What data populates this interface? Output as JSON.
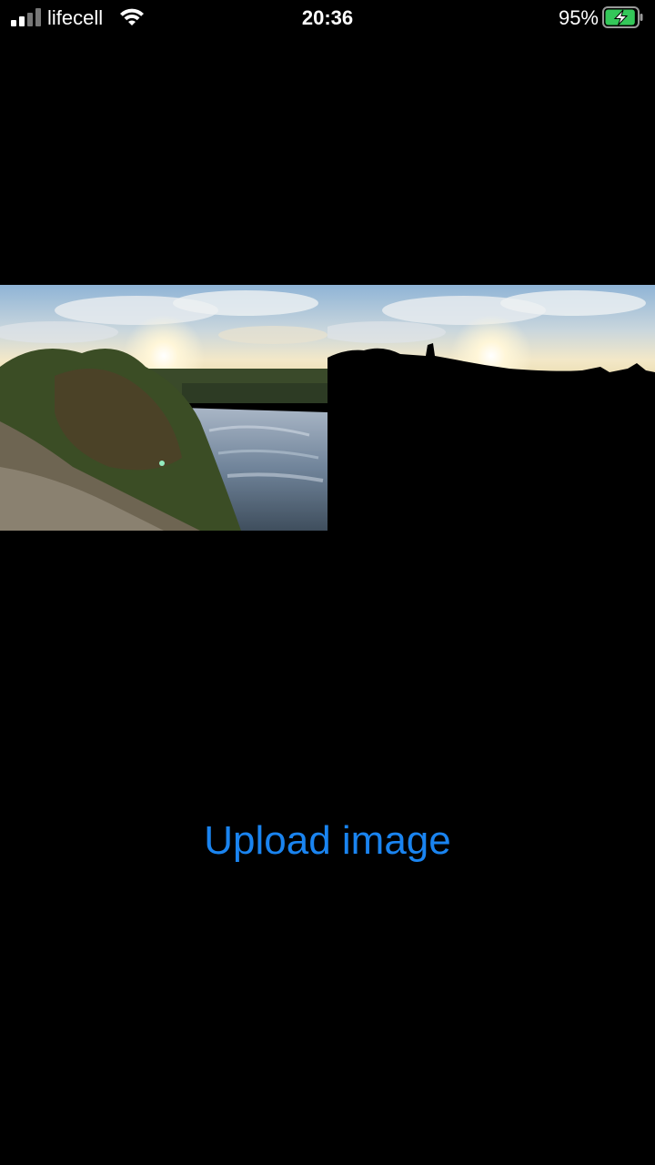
{
  "status_bar": {
    "carrier": "lifecell",
    "time": "20:36",
    "battery_percent": "95%",
    "signal_icon": "cellular-signal-icon",
    "wifi_icon": "wifi-icon",
    "battery_icon": "battery-charging-icon",
    "battery_level": 0.95,
    "battery_color": "#34c759"
  },
  "images": {
    "original": {
      "description_icon": "photo-sunset-lake"
    },
    "segmented": {
      "description_icon": "photo-sky-segmentation-mask"
    }
  },
  "upload": {
    "label": "Upload image",
    "color": "#1a84f0"
  }
}
